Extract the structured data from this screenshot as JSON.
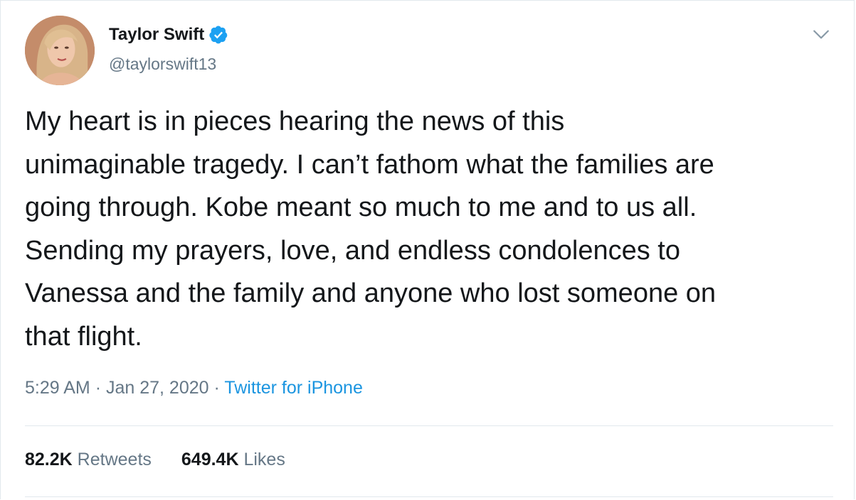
{
  "user": {
    "display_name": "Taylor Swift",
    "handle": "@taylorswift13",
    "verified_icon": "verified-badge-icon"
  },
  "tweet": {
    "text": "My heart is in pieces hearing the news of this\nunimaginable tragedy. I can’t fathom what the families are\ngoing through. Kobe meant so much to me and to us all.\nSending my prayers, love, and endless condolences to\nVanessa and the family and anyone who lost someone on\nthat flight.",
    "time": "5:29 AM",
    "date": "Jan 27, 2020",
    "separator": "·",
    "source": "Twitter for iPhone"
  },
  "stats": {
    "retweets_count": "82.2K",
    "retweets_label": "Retweets",
    "likes_count": "649.4K",
    "likes_label": "Likes"
  },
  "colors": {
    "verified_blue": "#1da1f2",
    "link_blue": "#1b95e0",
    "secondary_text": "#657786",
    "divider": "#e1e8ed"
  }
}
